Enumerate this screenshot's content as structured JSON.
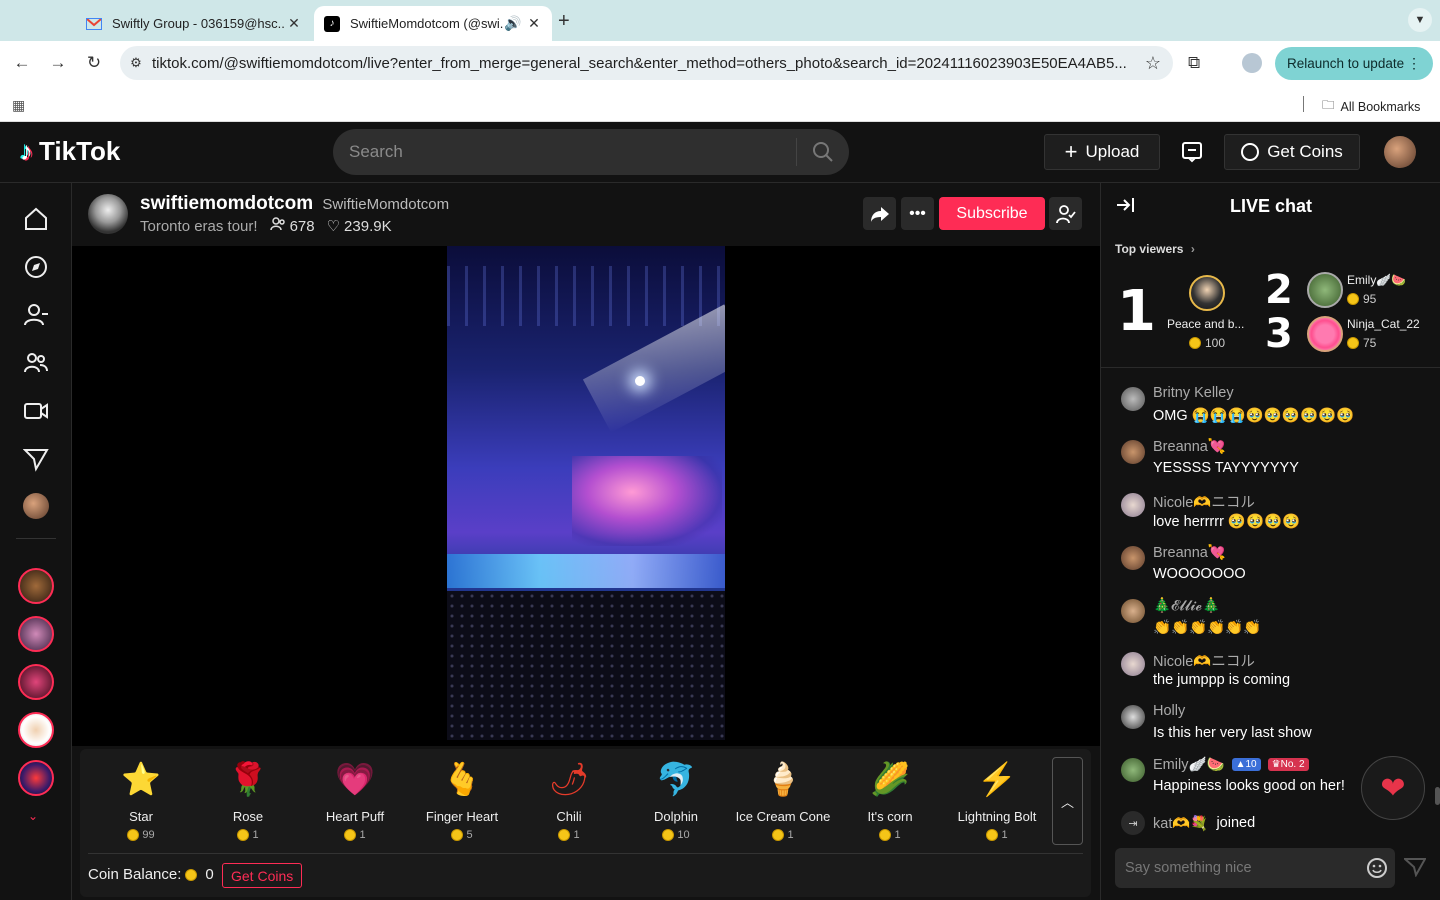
{
  "browser": {
    "tabs": [
      {
        "title": "Swiftly Group - 036159@hsc...",
        "favicon": "gmail-icon"
      },
      {
        "title": "SwiftieMomdotcom (@swi...",
        "favicon": "tiktok-icon"
      }
    ],
    "url": "tiktok.com/@swiftiemomdotcom/live?enter_from_merge=general_search&enter_method=others_photo&search_id=20241116023903E50EA4AB5...",
    "relaunch_label": "Relaunch to update",
    "all_bookmarks": "All Bookmarks"
  },
  "header": {
    "logo_text": "TikTok",
    "search_placeholder": "Search",
    "upload_label": "Upload",
    "get_coins_label": "Get Coins"
  },
  "streamer": {
    "username": "swiftiemomdotcom",
    "nickname": "SwiftieMomdotcom",
    "title": "Toronto eras tour!",
    "viewers": "678",
    "likes": "239.9K",
    "subscribe_label": "Subscribe"
  },
  "gifts": [
    {
      "name": "Star",
      "price": "99",
      "icon": "star-icon",
      "glyph": "⭐"
    },
    {
      "name": "Rose",
      "price": "1",
      "icon": "rose-icon",
      "glyph": "🌹"
    },
    {
      "name": "Heart Puff",
      "price": "1",
      "icon": "heart-puff-icon",
      "glyph": "💗"
    },
    {
      "name": "Finger Heart",
      "price": "5",
      "icon": "finger-heart-icon",
      "glyph": "🫰"
    },
    {
      "name": "Chili",
      "price": "1",
      "icon": "chili-icon",
      "glyph": "🌶"
    },
    {
      "name": "Dolphin",
      "price": "10",
      "icon": "dolphin-icon",
      "glyph": "🐬"
    },
    {
      "name": "Ice Cream Cone",
      "price": "1",
      "icon": "ice-cream-icon",
      "glyph": "🍦"
    },
    {
      "name": "It's corn",
      "price": "1",
      "icon": "corn-icon",
      "glyph": "🌽"
    },
    {
      "name": "Lightning Bolt",
      "price": "1",
      "icon": "lightning-icon",
      "glyph": "⚡"
    }
  ],
  "coin_balance_label": "Coin Balance:",
  "coin_balance": "0",
  "get_coins_label": "Get Coins",
  "chat": {
    "title": "LIVE chat",
    "top_viewers_label": "Top viewers",
    "top_viewers": [
      {
        "rank": "1",
        "name": "Peace and b...",
        "coins": "100"
      },
      {
        "rank": "2",
        "name": "Emily🪽🍉",
        "coins": "95"
      },
      {
        "rank": "3",
        "name": "Ninja_Cat_22",
        "coins": "75"
      }
    ],
    "messages": [
      {
        "name": "Britny Kelley",
        "text": "OMG 😭😭😭🥹🥹🥹🥹🥹🥹"
      },
      {
        "name": "Breanna💘",
        "text": "YESSSS TAYYYYYYY"
      },
      {
        "name": "Nicole🫶ニコル",
        "text": "love herrrrr 🥹🥹🥹🥹"
      },
      {
        "name": "Breanna💘",
        "text": "WOOOOOOO"
      },
      {
        "name": "🎄𝓔𝓵𝓵𝓲𝓮🎄",
        "text": "👏👏👏👏👏👏"
      },
      {
        "name": "Nicole🫶ニコル",
        "text": "the jumppp is coming"
      },
      {
        "name": "Holly",
        "text": "Is this her very last show"
      },
      {
        "name": "Emily🪽🍉",
        "text": "Happiness looks good on her!",
        "badges": [
          "10",
          "No. 2"
        ]
      }
    ],
    "joined_user": "kat🫶💐",
    "joined_text": "joined",
    "input_placeholder": "Say something nice"
  }
}
